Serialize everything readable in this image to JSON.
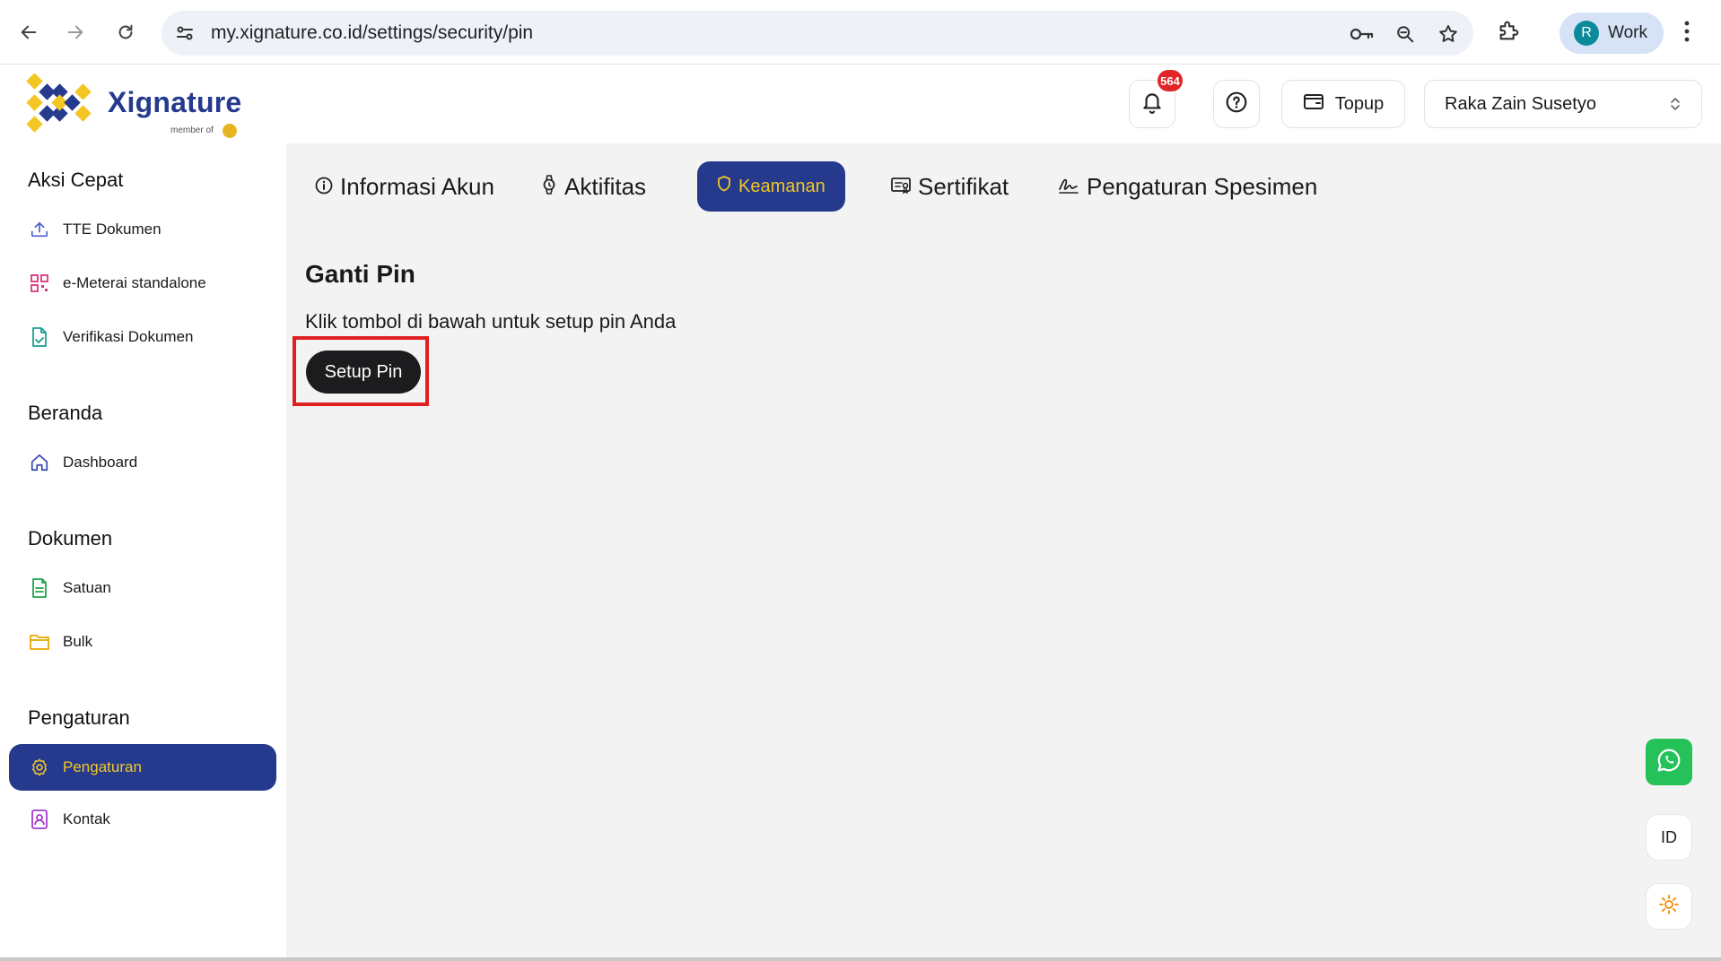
{
  "browser": {
    "url": "my.xignature.co.id/settings/security/pin",
    "profile_initial": "R",
    "profile_label": "Work",
    "icons": [
      "back-icon",
      "forward-icon",
      "reload-icon",
      "site-settings-icon",
      "password-key-icon",
      "zoom-icon",
      "bookmark-star-icon",
      "extensions-icon",
      "more-vert-icon"
    ]
  },
  "header": {
    "brand": "Xignature",
    "brand_sub": "member of",
    "notification_count": "564",
    "topup_label": "Topup",
    "user_name": "Raka Zain Susetyo"
  },
  "sidebar": {
    "sections": [
      {
        "title": "Aksi Cepat"
      },
      {
        "title": "Beranda"
      },
      {
        "title": "Dokumen"
      },
      {
        "title": "Pengaturan"
      }
    ],
    "items": [
      {
        "label": "TTE Dokumen",
        "icon": "upload-icon"
      },
      {
        "label": "e-Meterai standalone",
        "icon": "qr-icon"
      },
      {
        "label": "Verifikasi Dokumen",
        "icon": "document-check-icon"
      },
      {
        "label": "Dashboard",
        "icon": "home-icon"
      },
      {
        "label": "Satuan",
        "icon": "file-icon"
      },
      {
        "label": "Bulk",
        "icon": "folder-icon"
      },
      {
        "label": "Pengaturan",
        "icon": "gear-icon",
        "active": true
      },
      {
        "label": "Kontak",
        "icon": "contact-book-icon"
      }
    ]
  },
  "tabs": [
    {
      "label": "Informasi Akun",
      "icon": "info-icon"
    },
    {
      "label": "Aktifitas",
      "icon": "watch-icon"
    },
    {
      "label": "Keamanan",
      "icon": "shield-icon",
      "active": true
    },
    {
      "label": "Sertifikat",
      "icon": "certificate-icon"
    },
    {
      "label": "Pengaturan Spesimen",
      "icon": "signature-icon"
    }
  ],
  "content": {
    "title": "Ganti Pin",
    "description": "Klik tombol di bawah untuk setup pin Anda",
    "button_label": "Setup Pin"
  },
  "floating": {
    "language": "ID"
  },
  "colors": {
    "brand_navy": "#253a8d",
    "brand_yellow": "#f3c623",
    "badge_red": "#e02626",
    "whatsapp_green": "#25c25a",
    "highlight_red": "#e02020"
  }
}
